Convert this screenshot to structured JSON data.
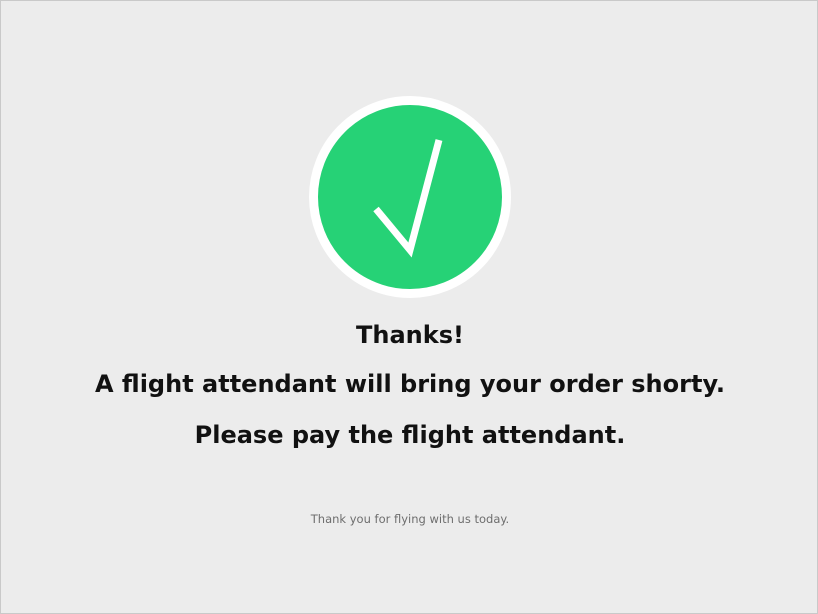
{
  "confirmation": {
    "icon": "checkmark-icon",
    "title": "Thanks!",
    "message_line_1": "A flight attendant will bring your order shorty.",
    "message_line_2": "Please pay the flight attendant.",
    "footer": "Thank you for flying with us today."
  },
  "colors": {
    "background": "#ececec",
    "success_green": "#26d276",
    "badge_ring": "#ffffff",
    "text": "#111111",
    "footer_text": "#6e6e6e"
  }
}
